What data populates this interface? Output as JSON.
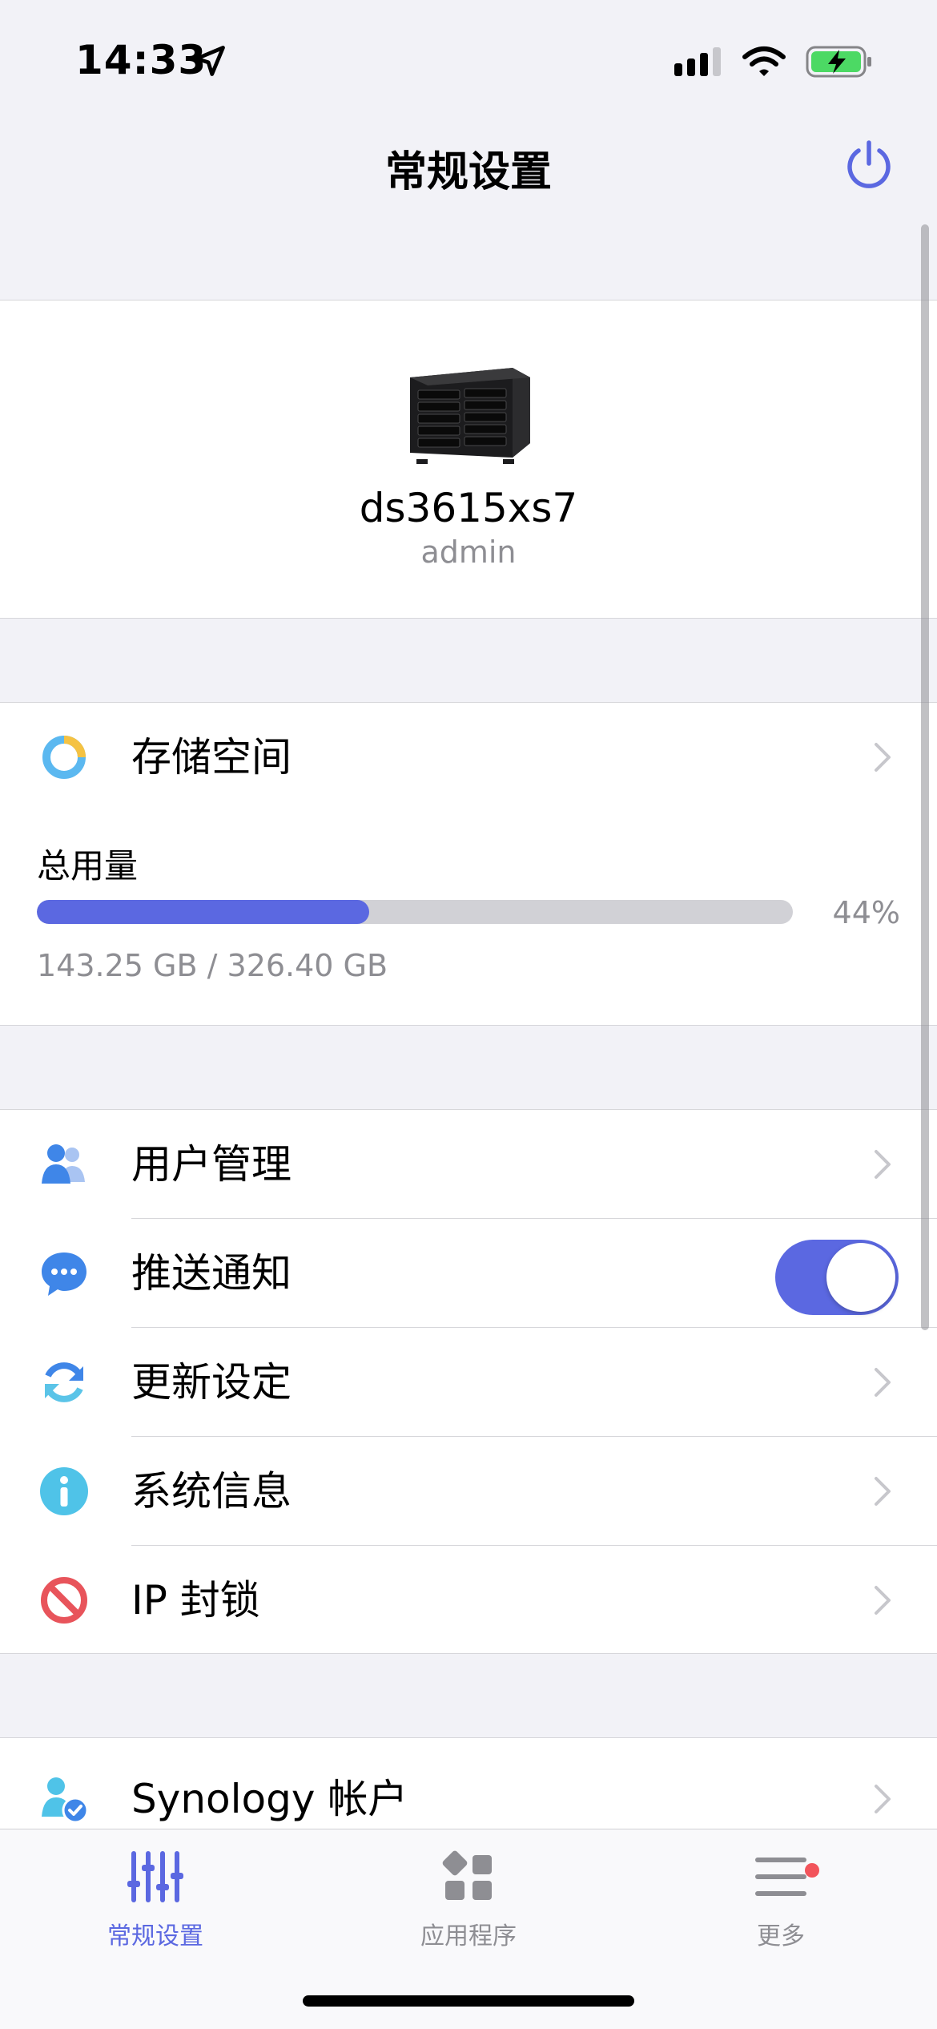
{
  "status_bar": {
    "time": "14:33",
    "battery_color": "#4cd964"
  },
  "nav": {
    "title": "常规设置"
  },
  "device": {
    "name": "ds3615xs7",
    "user": "admin"
  },
  "storage": {
    "label": "存储空间",
    "usage_label": "总用量",
    "usage_fraction": 0.44,
    "percent_text": "44%",
    "detail": "143.25 GB / 326.40 GB"
  },
  "settings": {
    "items": [
      {
        "label": "用户管理",
        "icon": "users-icon"
      },
      {
        "label": "推送通知",
        "icon": "chat-bubble-icon",
        "toggle_on": true
      },
      {
        "label": "更新设定",
        "icon": "refresh-icon"
      },
      {
        "label": "系统信息",
        "icon": "info-icon"
      },
      {
        "label": "IP 封锁",
        "icon": "block-icon"
      }
    ]
  },
  "account": {
    "label": "Synology 帐户",
    "icon": "user-check-icon"
  },
  "tabbar": {
    "tabs": [
      {
        "label": "常规设置",
        "icon": "sliders-icon",
        "active": true
      },
      {
        "label": "应用程序",
        "icon": "apps-icon",
        "active": false
      },
      {
        "label": "更多",
        "icon": "menu-icon",
        "active": false,
        "badge": true
      }
    ]
  },
  "colors": {
    "accent": "#5b68e1",
    "background": "#f2f2f7",
    "badge": "#f2545b"
  }
}
